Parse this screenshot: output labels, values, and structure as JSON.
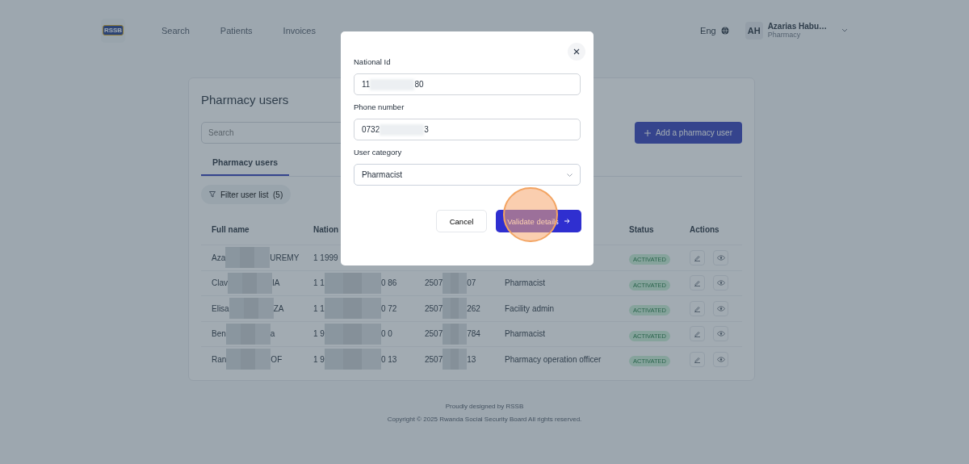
{
  "header": {
    "logo": "RSSB",
    "nav": [
      {
        "label": "Search",
        "selected": false
      },
      {
        "label": "Patients",
        "selected": false
      },
      {
        "label": "Invoices",
        "selected": false
      }
    ],
    "language": "Eng",
    "user": {
      "initials": "AH",
      "name": "Azarias Habu…",
      "role": "Pharmacy"
    }
  },
  "page": {
    "title": "Pharmacy users",
    "search": {
      "placeholder": "Search"
    },
    "add_button": "Add a pharmacy user",
    "tabs": [
      {
        "label": "Pharmacy users",
        "selected": true
      }
    ],
    "filter": {
      "label": "Filter user list",
      "count": "(5)"
    },
    "table": {
      "columns": [
        {
          "kind": "name",
          "label": "Full name"
        },
        {
          "kind": "national_id",
          "label": "Nation"
        },
        {
          "kind": "status",
          "label": "Status"
        },
        {
          "kind": "actions",
          "label": "Actions"
        }
      ],
      "rows": [
        {
          "full_name": [
            "Aza",
            "UREMY"
          ],
          "national_id": [
            "1 1999"
          ],
          "status": "ACTIVATED"
        },
        {
          "full_name": [
            "Clav",
            "IA"
          ],
          "national_id": [
            "1 1",
            "0 86"
          ],
          "phone": [
            "2507",
            "07"
          ],
          "category": "Pharmacist",
          "status": "ACTIVATED"
        },
        {
          "full_name": [
            "Elisa",
            "ZA"
          ],
          "national_id": [
            "1 1",
            "0 72"
          ],
          "phone": [
            "2507",
            "262"
          ],
          "category": "Facility admin",
          "status": "ACTIVATED"
        },
        {
          "full_name": [
            "Ben",
            "a"
          ],
          "national_id": [
            "1 9",
            "0 0"
          ],
          "phone": [
            "2507",
            "784"
          ],
          "category": "Pharmacist",
          "status": "ACTIVATED"
        },
        {
          "full_name": [
            "Ran",
            "OF"
          ],
          "national_id": [
            "1 9",
            "0 13"
          ],
          "phone": [
            "2507",
            "13"
          ],
          "category": "Pharmacy operation officer",
          "status": "ACTIVATED"
        }
      ]
    }
  },
  "modal": {
    "fields": [
      {
        "kind": "text",
        "label": "National Id",
        "value_parts": [
          "11",
          "80"
        ]
      },
      {
        "kind": "text",
        "label": "Phone number",
        "value_parts": [
          "0732",
          "3"
        ]
      },
      {
        "kind": "select",
        "label": "User category",
        "value": "Pharmacist"
      }
    ],
    "cancel_button": "Cancel",
    "submit_button": {
      "label": "Validate details",
      "click_marker": true
    }
  },
  "footer": {
    "lines": [
      "Proudly designed by RSSB",
      "Copyright © 2025 Rwanda Social Security Board All rights reserved."
    ]
  }
}
